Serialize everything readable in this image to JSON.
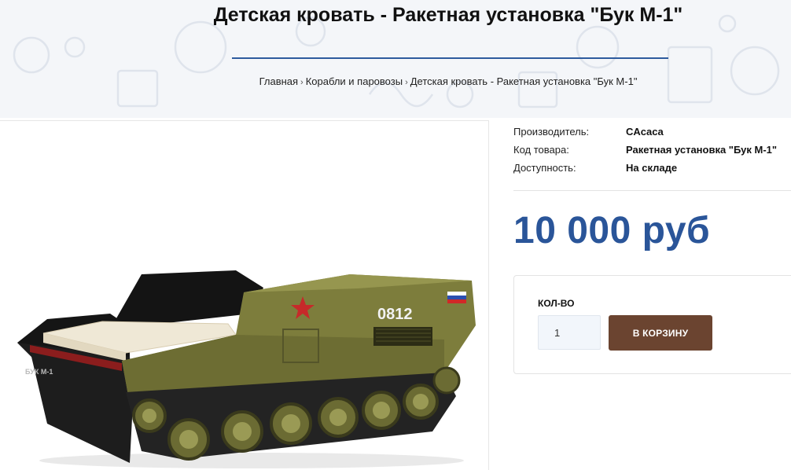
{
  "page": {
    "title": "Детская кровать - Ракетная установка \"Бук М-1\""
  },
  "breadcrumb": {
    "items": [
      "Главная",
      "Корабли и паровозы",
      "Детская кровать - Ракетная установка \"Бук М-1\""
    ],
    "separator": "›"
  },
  "product_image": {
    "number": "0812",
    "side_label": "БУК М-1"
  },
  "specs": [
    {
      "label": "Производитель:",
      "value": "CAcaca"
    },
    {
      "label": "Код товара:",
      "value": "Ракетная установка \"Бук М-1\""
    },
    {
      "label": "Доступность:",
      "value": "На складе"
    }
  ],
  "price": "10 000 руб",
  "buy": {
    "qty_label": "КОЛ-ВО",
    "qty_value": "1",
    "cart_label": "В КОРЗИНУ"
  },
  "colors": {
    "accent_blue": "#2a5599",
    "cart_button": "#6b4430",
    "tank_green": "#7a7a3a"
  }
}
